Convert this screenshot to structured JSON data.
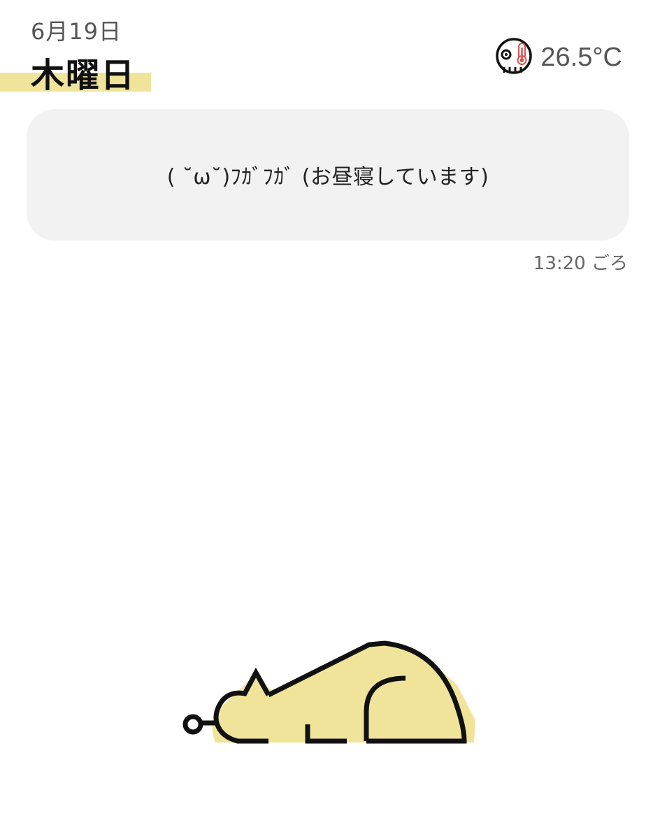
{
  "header": {
    "date": "6月19日",
    "weekday": "木曜日",
    "temperature": "26.5°C",
    "temperature_icon": "room-thermometer-icon"
  },
  "status": {
    "message": "( ˘ω˘)ﾌｶﾞﾌｶﾞ (お昼寝しています)",
    "time": "13:20 ごろ"
  },
  "illustration": {
    "name": "sleeping-cat-illustration",
    "accent_color": "#f0e49a",
    "line_color": "#111111"
  },
  "colors": {
    "highlight": "#f0e49a",
    "card_background": "#f2f2f2",
    "muted_text": "#555555"
  }
}
